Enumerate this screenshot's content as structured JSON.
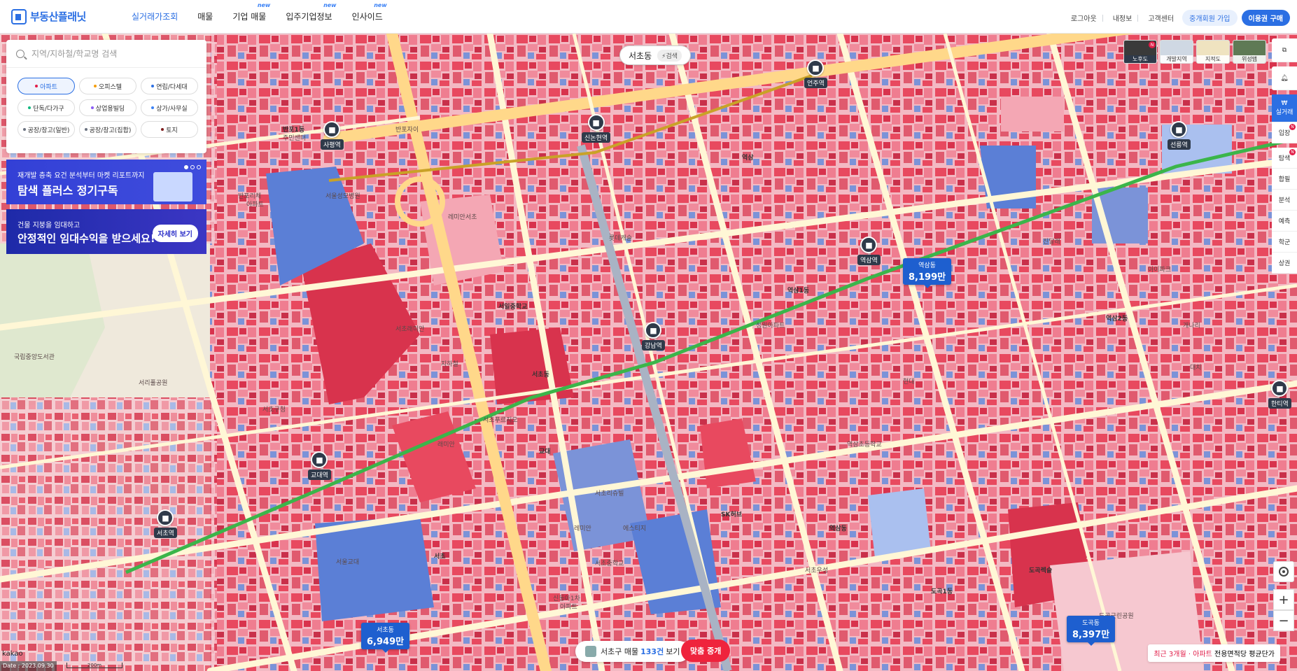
{
  "header": {
    "logo_text": "부동산플래닛",
    "nav": [
      {
        "label": "실거래가조회",
        "active": true,
        "new": ""
      },
      {
        "label": "매물",
        "active": false,
        "new": ""
      },
      {
        "label": "기업 매물",
        "active": false,
        "new": "new"
      },
      {
        "label": "입주기업정보",
        "active": false,
        "new": "new"
      },
      {
        "label": "인사이드",
        "active": false,
        "new": "new"
      }
    ],
    "links": {
      "logout": "로그아웃",
      "myinfo": "내정보",
      "support": "고객센터",
      "join_broker": "중개회원 가입",
      "buy_pass": "이용권 구매"
    }
  },
  "search": {
    "placeholder": "지역/지하철/학교명 검색"
  },
  "property_types": [
    {
      "label": "아파트",
      "color": "#e11d48",
      "selected": true
    },
    {
      "label": "오피스텔",
      "color": "#f59e0b",
      "selected": false
    },
    {
      "label": "연립/다세대",
      "color": "#2b6fe3",
      "selected": false
    },
    {
      "label": "단독/다가구",
      "color": "#10b981",
      "selected": false
    },
    {
      "label": "상업용빌딩",
      "color": "#8b5cf6",
      "selected": false
    },
    {
      "label": "상가/사무실",
      "color": "#3b82f6",
      "selected": false
    },
    {
      "label": "공장/창고(일반)",
      "color": "#6b7280",
      "selected": false
    },
    {
      "label": "공장/창고(집합)",
      "color": "#6b7280",
      "selected": false
    },
    {
      "label": "토지",
      "color": "#7f1d1d",
      "selected": false
    }
  ],
  "banners": {
    "b1_sub": "재개발 층축 요건 분석부터 마켓 리포트까지",
    "b1_main": "탐색 플러스 정기구독",
    "b2_sub": "건물 지붕을 임대하고",
    "b2_main": "안정적인 임대수익을 받으세요!",
    "b2_btn": "자세히 보기"
  },
  "dong_pill": {
    "name": "서초동",
    "search": "⚡검색"
  },
  "layers": [
    {
      "label": "노후도",
      "active": true,
      "badge": "N"
    },
    {
      "label": "개발지역",
      "active": false,
      "badge": ""
    },
    {
      "label": "지적도",
      "active": false,
      "badge": ""
    },
    {
      "label": "위성맵",
      "active": false,
      "badge": ""
    }
  ],
  "rail": [
    {
      "label": "실거래",
      "active": true,
      "badge": ""
    },
    {
      "label": "입장",
      "active": false,
      "badge": "N"
    },
    {
      "label": "탐색",
      "active": false,
      "badge": "N"
    },
    {
      "label": "합필",
      "active": false,
      "badge": ""
    },
    {
      "label": "분석",
      "active": false,
      "badge": ""
    },
    {
      "label": "예측",
      "active": false,
      "badge": ""
    },
    {
      "label": "학군",
      "active": false,
      "badge": ""
    },
    {
      "label": "상권",
      "active": false,
      "badge": ""
    }
  ],
  "stations": [
    {
      "name": "사평역"
    },
    {
      "name": "신논현역"
    },
    {
      "name": "언주역"
    },
    {
      "name": "선릉역"
    },
    {
      "name": "역삼역"
    },
    {
      "name": "강남역"
    },
    {
      "name": "교대역"
    },
    {
      "name": "서초역"
    },
    {
      "name": "한티역"
    }
  ],
  "price_tags": [
    {
      "area": "역삼동",
      "value": "8,199만"
    },
    {
      "area": "서초동",
      "value": "6,949만"
    },
    {
      "area": "도곡동",
      "value": "8,397만"
    }
  ],
  "place_labels": [
    "반포1동",
    "주민센터",
    "반포리체",
    "아파트",
    "서울성모병원",
    "반포자이",
    "서초래미안",
    "레미안서초",
    "서일중학교",
    "서초동",
    "역삼1동",
    "역삼2동",
    "도곡1동",
    "역삼동",
    "대치",
    "서초구청",
    "교대",
    "레미안",
    "에스티지",
    "서울교대",
    "서초중학교",
    "신동아1차",
    "아파트",
    "서초",
    "래미안",
    "도곡렉슬",
    "도곡근린공원",
    "국립중앙도서관",
    "서리풀공원",
    "지하철",
    "서초리슈빌",
    "롯데캐슬",
    "역삼초등학교",
    "SK허브",
    "서초푸르지오",
    "현대",
    "진달래",
    "서초우성",
    "성원아파트",
    "역삼",
    "아이파크",
    "개나리"
  ],
  "bottom": {
    "region": "서초구 매물",
    "count": "133건",
    "view": "보기",
    "broker": "맞춤 중개"
  },
  "legend_note": {
    "prefix": "최근 3개월 · 아파트",
    "suffix": "전용면적당 평균단가"
  },
  "attribution": {
    "kakao": "kakao",
    "date": "Date : 2023.09.30",
    "scale": "200m"
  },
  "map_colors": {
    "road": "#fff7d6",
    "major_road": "#ffd88a",
    "red": "#e8495f",
    "pink": "#f4a7b4",
    "blue": "#5b7fd6",
    "lightblue": "#aac0ef",
    "green_line": "#3bb54a"
  }
}
